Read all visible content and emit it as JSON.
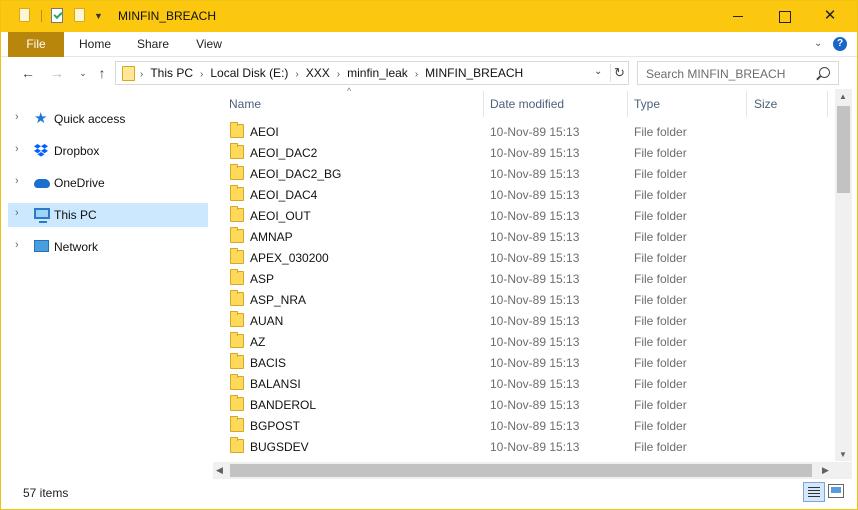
{
  "window": {
    "title": "MINFIN_BREACH",
    "controls": {
      "minimize": "",
      "maximize": "",
      "close": "✕"
    }
  },
  "ribbon": {
    "tabs": [
      "File",
      "Home",
      "Share",
      "View"
    ]
  },
  "address": {
    "crumbs": [
      "This PC",
      "Local Disk (E:)",
      "XXX",
      "minfin_leak",
      "MINFIN_BREACH"
    ]
  },
  "search": {
    "placeholder": "Search MINFIN_BREACH"
  },
  "nav": {
    "items": [
      {
        "label": "Quick access",
        "icon": "star-icon"
      },
      {
        "label": "Dropbox",
        "icon": "dropbox-icon"
      },
      {
        "label": "OneDrive",
        "icon": "onedrive-icon"
      },
      {
        "label": "This PC",
        "icon": "computer-icon",
        "selected": true
      },
      {
        "label": "Network",
        "icon": "network-icon"
      }
    ]
  },
  "columns": {
    "name": "Name",
    "date": "Date modified",
    "type": "Type",
    "size": "Size"
  },
  "files": [
    {
      "name": "AEOI",
      "date": "10-Nov-89 15:13",
      "type": "File folder"
    },
    {
      "name": "AEOI_DAC2",
      "date": "10-Nov-89 15:13",
      "type": "File folder"
    },
    {
      "name": "AEOI_DAC2_BG",
      "date": "10-Nov-89 15:13",
      "type": "File folder"
    },
    {
      "name": "AEOI_DAC4",
      "date": "10-Nov-89 15:13",
      "type": "File folder"
    },
    {
      "name": "AEOI_OUT",
      "date": "10-Nov-89 15:13",
      "type": "File folder"
    },
    {
      "name": "AMNAP",
      "date": "10-Nov-89 15:13",
      "type": "File folder"
    },
    {
      "name": "APEX_030200",
      "date": "10-Nov-89 15:13",
      "type": "File folder"
    },
    {
      "name": "ASP",
      "date": "10-Nov-89 15:13",
      "type": "File folder"
    },
    {
      "name": "ASP_NRA",
      "date": "10-Nov-89 15:13",
      "type": "File folder"
    },
    {
      "name": "AUAN",
      "date": "10-Nov-89 15:13",
      "type": "File folder"
    },
    {
      "name": "AZ",
      "date": "10-Nov-89 15:13",
      "type": "File folder"
    },
    {
      "name": "BACIS",
      "date": "10-Nov-89 15:13",
      "type": "File folder"
    },
    {
      "name": "BALANSI",
      "date": "10-Nov-89 15:13",
      "type": "File folder"
    },
    {
      "name": "BANDEROL",
      "date": "10-Nov-89 15:13",
      "type": "File folder"
    },
    {
      "name": "BGPOST",
      "date": "10-Nov-89 15:13",
      "type": "File folder"
    },
    {
      "name": "BUGSDEV",
      "date": "10-Nov-89 15:13",
      "type": "File folder"
    }
  ],
  "status": {
    "count": "57 items"
  },
  "colors": {
    "titlebar": "#fcc80f",
    "file_tab": "#b8860b",
    "selected": "#cce8ff",
    "header_text": "#4c607a"
  }
}
